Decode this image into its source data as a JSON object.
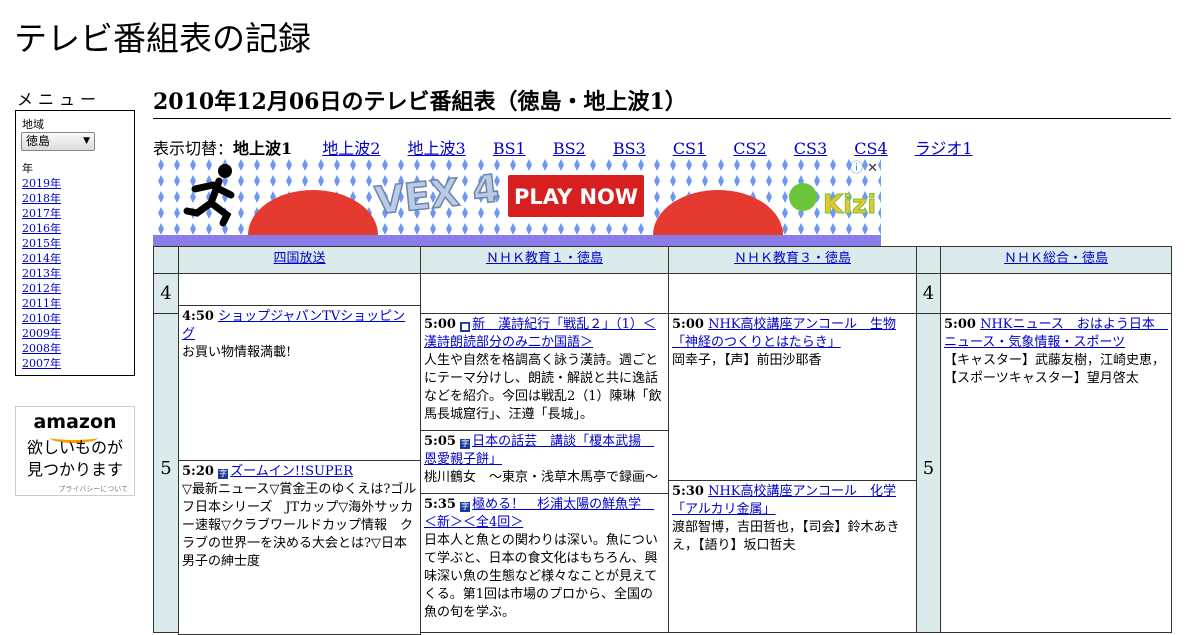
{
  "site_title": "テレビ番組表の記録",
  "menu": {
    "heading": "メニュー",
    "region_label": "地域",
    "region_value": "徳島",
    "year_label": "年",
    "years": [
      "2019年",
      "2018年",
      "2017年",
      "2016年",
      "2015年",
      "2014年",
      "2013年",
      "2012年",
      "2011年",
      "2010年",
      "2009年",
      "2008年",
      "2007年"
    ]
  },
  "amazon_ad": {
    "logo": "amazon",
    "text_line1": "欲しいものが",
    "text_line2": "見つかります",
    "privacy": "プライバシーについて"
  },
  "page_heading": "2010年12月06日のテレビ番組表（徳島・地上波1）",
  "channel_switch": {
    "label": "表示切替：",
    "current": "地上波1",
    "links": [
      "地上波2",
      "地上波3",
      "BS1",
      "BS2",
      "BS3",
      "CS1",
      "CS2",
      "CS3",
      "CS4",
      "ラジオ1"
    ]
  },
  "game_ad": {
    "play_label": "PLAY NOW",
    "game_name": "VEX 4",
    "brand": "Kizi",
    "info_icon": "ⓘ",
    "close_icon": "✕"
  },
  "schedule": {
    "channels": [
      "四国放送",
      "ＮＨＫ教育１・徳島",
      "ＮＨＫ教育３・徳島",
      "ＮＨＫ総合・徳島"
    ],
    "hours": [
      "4",
      "5"
    ],
    "programs": {
      "shikoku_450": {
        "time": "4:50",
        "title": "ショップジャパンTVショッピング",
        "desc": "お買い物情報満載!"
      },
      "shikoku_520": {
        "time": "5:20",
        "title": "ズームイン!!SUPER",
        "desc": "▽最新ニュース▽賞金王のゆくえは?ゴルフ日本シリーズ　JTカップ▽海外サッカー速報▽クラブワールドカップ情報　クラブの世界一を決める大会とは?▽日本男子の紳士度"
      },
      "edu1_500": {
        "time": "5:00",
        "title": "新　漢詩紀行「戦乱２」（1）＜漢詩朗読部分のみ二か国語＞",
        "desc": "人生や自然を格調高く詠う漢詩。週ごとにテーマ分けし、朗読・解説と共に逸話などを紹介。今回は戦乱2（1）陳琳「飲馬長城窟行」、汪遵「長城」。"
      },
      "edu1_505": {
        "time": "5:05",
        "title": "日本の話芸　講談「榎本武揚　恩愛親子餅」",
        "desc": "桃川鶴女　～東京・浅草木馬亭で録画～"
      },
      "edu1_535": {
        "time": "5:35",
        "title": "極める！　杉浦太陽の鮮魚学　＜新＞＜全4回＞",
        "desc": "日本人と魚との関わりは深い。魚について学ぶと、日本の食文化はもちろん、興味深い魚の生態など様々なことが見えてくる。第1回は市場のプロから、全国の魚の旬を学ぶ。"
      },
      "edu3_500": {
        "time": "5:00",
        "title": "NHK高校講座アンコール　生物「神経のつくりとはたらき」",
        "desc": "岡幸子，【声】前田沙耶香"
      },
      "edu3_530": {
        "time": "5:30",
        "title": "NHK高校講座アンコール　化学「アルカリ金属」",
        "desc": "渡部智博，吉田哲也，【司会】鈴木あきえ，【語り】坂口哲夫"
      },
      "sogo_500": {
        "time": "5:00",
        "title": "NHKニュース　おはよう日本　ニュース・気象情報・スポーツ",
        "desc": "【キャスター】武藤友樹，江崎史恵，【スポーツキャスター】望月啓太"
      }
    }
  }
}
